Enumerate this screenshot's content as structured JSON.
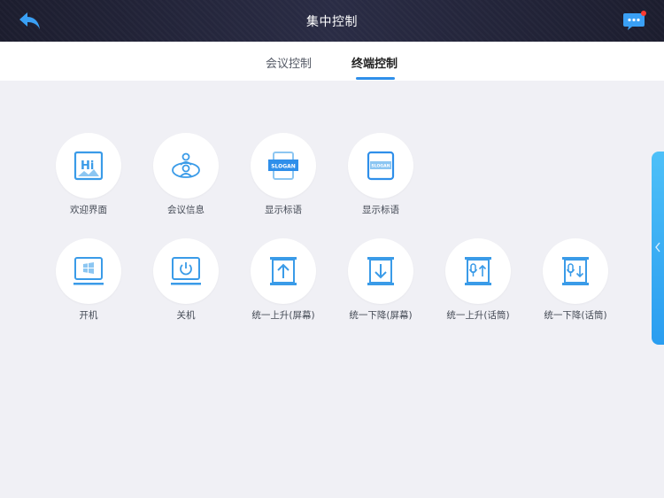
{
  "header": {
    "title": "集中控制",
    "back_icon": "back-arrow-icon",
    "chat_icon": "chat-bubble-icon"
  },
  "tabs": [
    {
      "label": "会议控制",
      "active": false
    },
    {
      "label": "终端控制",
      "active": true
    }
  ],
  "controls": {
    "row1": [
      {
        "label": "欢迎界面",
        "icon": "hi-welcome-icon"
      },
      {
        "label": "会议信息",
        "icon": "meeting-info-icon"
      },
      {
        "label": "显示标语",
        "icon": "slogan-icon"
      },
      {
        "label": "显示标语",
        "icon": "slogan-small-icon"
      }
    ],
    "row2": [
      {
        "label": "开机",
        "icon": "power-on-icon"
      },
      {
        "label": "关机",
        "icon": "power-off-icon"
      },
      {
        "label": "统一上升(屏幕)",
        "icon": "screen-up-icon"
      },
      {
        "label": "统一下降(屏幕)",
        "icon": "screen-down-icon"
      },
      {
        "label": "统一上升(话筒)",
        "icon": "mic-up-icon"
      },
      {
        "label": "统一下降(话筒)",
        "icon": "mic-down-icon"
      }
    ]
  },
  "side_panel": {
    "icon": "chevron-left-icon"
  },
  "colors": {
    "accent": "#2f8fea",
    "icon_blue": "#3a9be8",
    "header_bg": "#1c1d2e",
    "page_bg": "#f0f0f5"
  }
}
